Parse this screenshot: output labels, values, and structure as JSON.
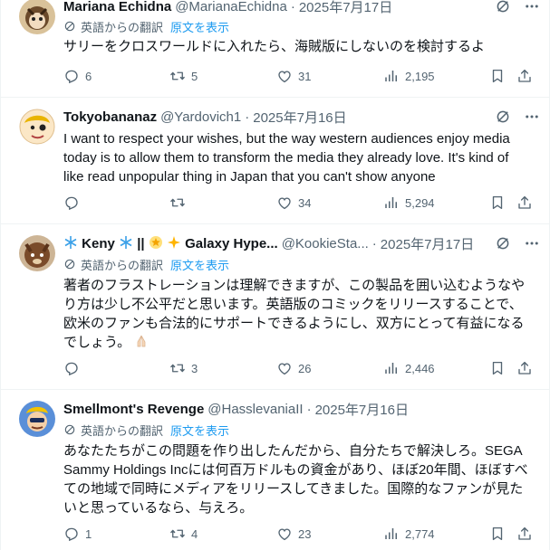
{
  "feed": {
    "posts": [
      {
        "name": "Mariana Echidna",
        "handle": "@MarianaEchidna",
        "date": "2025年7月17日",
        "translate_label": "英語からの翻訳",
        "show_original": "原文を表示",
        "text_lines": [
          "サリーをクロスワールドに入れたら、海賊版にしないのを検討するよ"
        ],
        "reply_count": "6",
        "retweet_count": "5",
        "like_count": "31",
        "view_count": "2,195"
      },
      {
        "name": "Tokyobananaz",
        "handle": "@Yardovich1",
        "date": "2025年7月16日",
        "text_lines": [
          "I want to respect your wishes, but the way western audiences enjoy media",
          "today is to allow them to transform the media they already love. It's kind of",
          "like read unpopular thing in Japan that you can't show anyone"
        ],
        "reply_count": "",
        "retweet_count": "",
        "like_count": "34",
        "view_count": "5,294"
      },
      {
        "name_parts": [
          "Keny",
          "||",
          "Galaxy Hype..."
        ],
        "handle": "@KookieSta...",
        "date": "2025年7月17日",
        "translate_label": "英語からの翻訳",
        "show_original": "原文を表示",
        "text_lines": [
          "著者のフラストレーションは理解できますが、この製品を囲い込むようなや",
          "り方は少し不公平だと思います。英語版のコミックをリリースすることで、",
          "欧米のファンも合法的にサポートできるようにし、双方にとって有益になる",
          "でしょう。"
        ],
        "reply_count": "",
        "retweet_count": "3",
        "like_count": "26",
        "view_count": "2,446"
      },
      {
        "name": "Smellmont's Revenge",
        "handle": "@HasslevaniaII",
        "date": "2025年7月16日",
        "translate_label": "英語からの翻訳",
        "show_original": "原文を表示",
        "text_lines": [
          "あなたたちがこの問題を作り出したんだから、自分たちで解決しろ。SEGA",
          "Sammy Holdings Incには何百万ドルもの資金があり、ほぼ20年間、ほぼすべ",
          "ての地域で同時にメディアをリリースしてきました。国際的なファンが見た",
          "いと思っているなら、与えろ。"
        ],
        "reply_count": "1",
        "retweet_count": "4",
        "like_count": "23",
        "view_count": "2,774"
      }
    ]
  }
}
